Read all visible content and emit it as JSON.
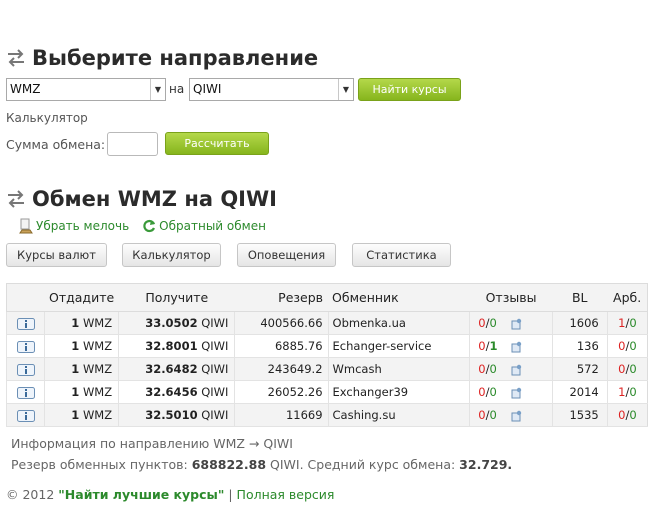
{
  "header": {
    "title": "Выберите направление"
  },
  "direction": {
    "from_value": "WMZ",
    "na_label": "на",
    "to_value": "QIWI",
    "find_button": "Найти курсы"
  },
  "calculator": {
    "heading": "Калькулятор",
    "sum_label": "Сумма обмена:",
    "sum_value": "",
    "calc_button": "Рассчитать"
  },
  "exchange": {
    "title": "Обмен WMZ на QIWI",
    "remove_change": "Убрать мелочь",
    "reverse": "Обратный обмен"
  },
  "tabs": [
    "Курсы валют",
    "Калькулятор",
    "Оповещения",
    "Статистика"
  ],
  "table": {
    "headers": [
      "",
      "Отдадите",
      "Получите",
      "Резерв",
      "Обменник",
      "Отзывы",
      "BL",
      "Арб."
    ],
    "rows": [
      {
        "give_amt": "1",
        "give_cur": "WMZ",
        "get_amt": "33.0502",
        "get_cur": "QIWI",
        "reserve": "400566.66",
        "exchanger": "Obmenka.ua",
        "rev_bad": "0",
        "rev_good": "0",
        "bl": "1606",
        "arb_a": "1",
        "arb_b": "0"
      },
      {
        "give_amt": "1",
        "give_cur": "WMZ",
        "get_amt": "32.8001",
        "get_cur": "QIWI",
        "reserve": "6885.76",
        "exchanger": "Echanger-service",
        "rev_bad": "0",
        "rev_good": "1",
        "bl": "136",
        "arb_a": "0",
        "arb_b": "0"
      },
      {
        "give_amt": "1",
        "give_cur": "WMZ",
        "get_amt": "32.6482",
        "get_cur": "QIWI",
        "reserve": "243649.2",
        "exchanger": "Wmcash",
        "rev_bad": "0",
        "rev_good": "0",
        "bl": "572",
        "arb_a": "0",
        "arb_b": "0"
      },
      {
        "give_amt": "1",
        "give_cur": "WMZ",
        "get_amt": "32.6456",
        "get_cur": "QIWI",
        "reserve": "26052.26",
        "exchanger": "Exchanger39",
        "rev_bad": "0",
        "rev_good": "0",
        "bl": "2014",
        "arb_a": "1",
        "arb_b": "0"
      },
      {
        "give_amt": "1",
        "give_cur": "WMZ",
        "get_amt": "32.5010",
        "get_cur": "QIWI",
        "reserve": "11669",
        "exchanger": "Cashing.su",
        "rev_bad": "0",
        "rev_good": "0",
        "bl": "1535",
        "arb_a": "0",
        "arb_b": "0"
      }
    ]
  },
  "info": {
    "direction_info": "Информация по направлению WMZ → QIWI",
    "reserve_label": "Резерв обменных пунктов:",
    "reserve_total": "688822.88",
    "reserve_cur": "QIWI.",
    "avg_label": "Средний курс обмена:",
    "avg_value": "32.729."
  },
  "footer": {
    "copyright": "© 2012",
    "brand": "\"Найти лучшие курсы\"",
    "separator": "|",
    "full_version": "Полная версия"
  },
  "colors": {
    "accent_green": "#8bbb22",
    "link_green": "#2c8a2c",
    "red": "#d22222"
  },
  "icons": [
    "arrows-swap-icon",
    "caret-down-icon",
    "broom-icon",
    "refresh-icon",
    "info-icon",
    "review-icon"
  ]
}
